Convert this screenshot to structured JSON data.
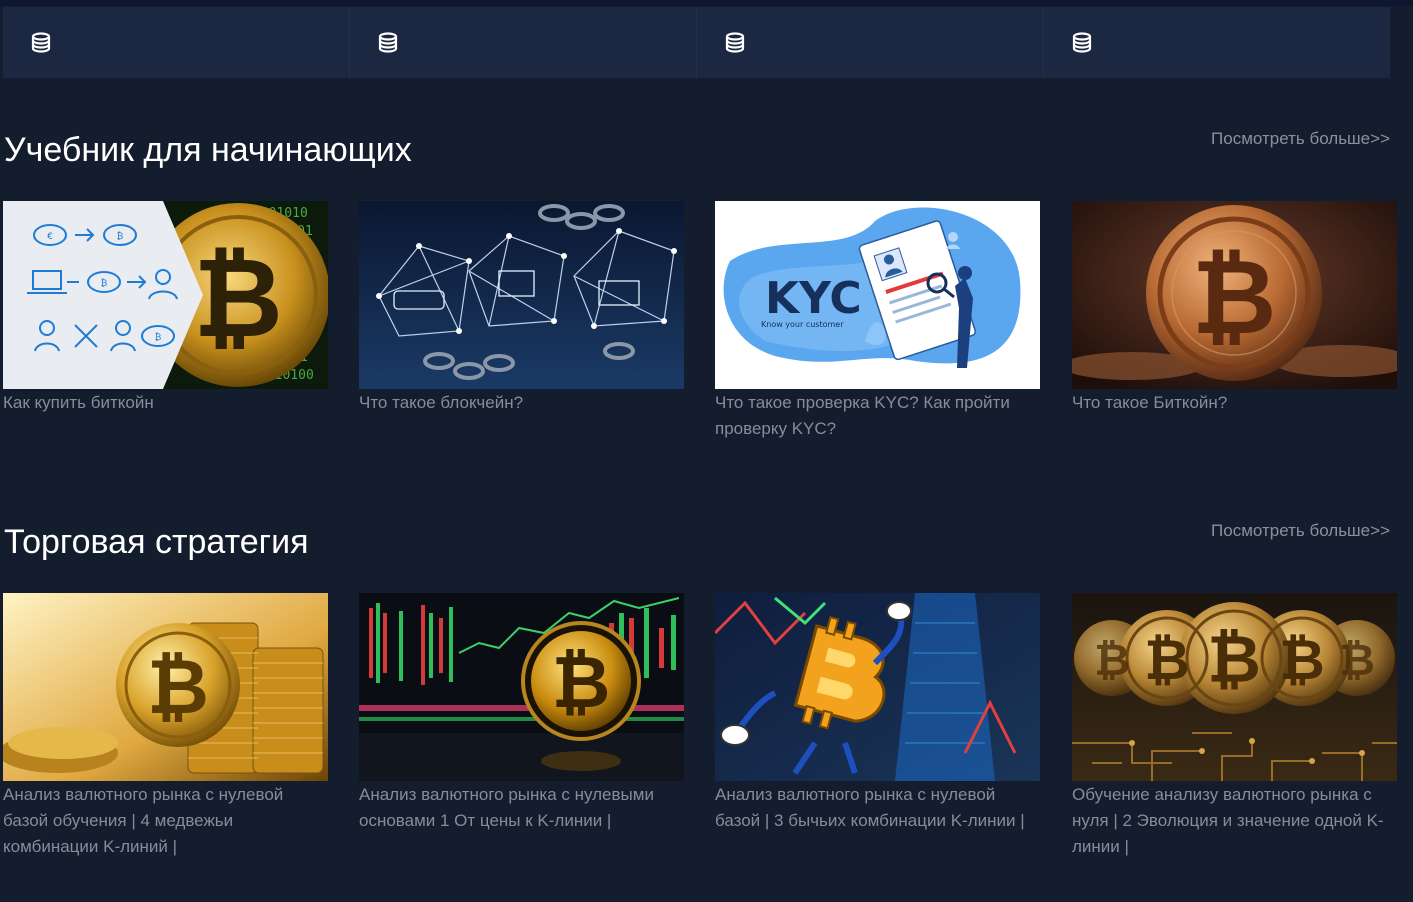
{
  "stats_bar": {
    "cells": [
      {
        "icon": "database-coins-icon"
      },
      {
        "icon": "database-coins-icon"
      },
      {
        "icon": "database-coins-icon"
      },
      {
        "icon": "database-coins-icon"
      }
    ]
  },
  "sections": [
    {
      "title": "Учебник для начинающих",
      "more_label": "Посмотреть больше>>",
      "cards": [
        {
          "title": "Как купить биткойн"
        },
        {
          "title": "Что такое блокчейн?"
        },
        {
          "title": "Что такое проверка KYC? Как пройти проверку KYC?",
          "image_text": "KYC",
          "image_subtext": "Know your customer"
        },
        {
          "title": "Что такое Биткойн?"
        }
      ]
    },
    {
      "title": "Торговая стратегия",
      "more_label": "Посмотреть больше>>",
      "cards": [
        {
          "title": "Анализ валютного рынка с нулевой базой обучения | 4 медвежьи комбинации K-линий |"
        },
        {
          "title": "Анализ валютного рынка с нулевыми основами 1 От цены к K-линии |"
        },
        {
          "title": "Анализ валютного рынка с нулевой базой | 3 бычьих комбинации K-линии |"
        },
        {
          "title": "Обучение анализу валютного рынка с нуля | 2 Эволюция и значение одной K-линии |"
        }
      ]
    }
  ],
  "colors": {
    "page_background": "#141d2d",
    "stats_bar_background": "#1c2742",
    "title_text": "#ffffff",
    "muted_text": "#868d99",
    "bitcoin_gold": "#e0a53a"
  }
}
